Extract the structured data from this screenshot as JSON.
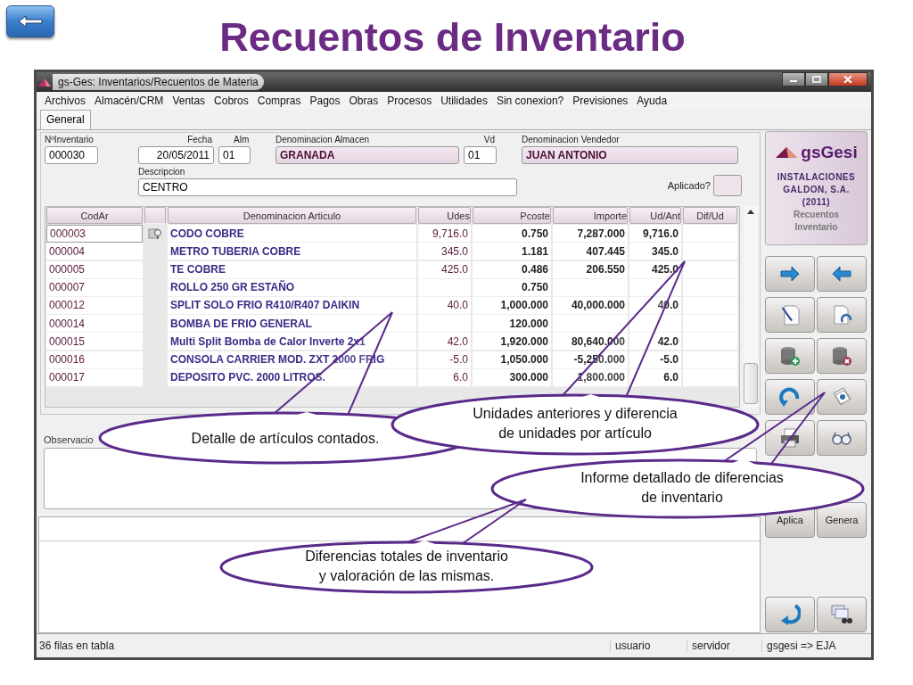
{
  "slide": {
    "title": "Recuentos de Inventario"
  },
  "window": {
    "title": "gs-Ges: Inventarios/Recuentos de Materia"
  },
  "menu": [
    "Archivos",
    "Almacén/CRM",
    "Ventas",
    "Cobros",
    "Compras",
    "Pagos",
    "Obras",
    "Procesos",
    "Utilidades",
    "Sin conexion?",
    "Previsiones",
    "Ayuda"
  ],
  "tabs": [
    {
      "label": "General",
      "selected": true
    }
  ],
  "form": {
    "fields": [
      {
        "label": "NºInventario",
        "value": "000030",
        "readonly": false
      },
      {
        "label": "Fecha",
        "value": "20/05/2011",
        "readonly": false
      },
      {
        "label": "Alm",
        "value": "01",
        "readonly": false
      },
      {
        "label": "Denominacion Almacen",
        "value": "GRANADA",
        "readonly": true
      },
      {
        "label": "Vd",
        "value": "01",
        "readonly": false
      },
      {
        "label": "Denominacion Vendedor",
        "value": "JUAN ANTONIO",
        "readonly": true
      }
    ],
    "descripcion": {
      "label": "Descripcion",
      "value": "CENTRO"
    },
    "aplicado": {
      "label": "Aplicado?",
      "checked": false
    }
  },
  "table": {
    "columns": [
      "CodAr",
      "Denominacion Articulo",
      "Udes",
      "Pcoste",
      "Importe",
      "Ud/Ant",
      "Dif/Ud"
    ],
    "rows": [
      {
        "codar": "000003",
        "articulo": "CODO COBRE",
        "udes": "9,716.0",
        "pcoste": "0.750",
        "importe": "7,287.000",
        "ud_ant": "9,716.0",
        "focused": true,
        "row_icon": true
      },
      {
        "codar": "000004",
        "articulo": "METRO TUBERIA COBRE",
        "udes": "345.0",
        "pcoste": "1.181",
        "importe": "407.445",
        "ud_ant": "345.0",
        "focused": false,
        "row_icon": false
      },
      {
        "codar": "000005",
        "articulo": "TE COBRE",
        "udes": "425.0",
        "pcoste": "0.486",
        "importe": "206.550",
        "ud_ant": "425.0",
        "focused": false,
        "row_icon": false
      },
      {
        "codar": "000007",
        "articulo": "ROLLO 250 GR ESTAÑO",
        "pcoste": "0.750",
        "focused": false,
        "row_icon": false
      },
      {
        "codar": "000012",
        "articulo": "SPLIT SOLO FRIO R410/R407 DAIKIN",
        "udes": "40.0",
        "pcoste": "1,000.000",
        "importe": "40,000.000",
        "ud_ant": "40.0",
        "focused": false,
        "row_icon": false
      },
      {
        "codar": "000014",
        "articulo": "BOMBA DE FRIO GENERAL",
        "pcoste": "120.000",
        "focused": false,
        "row_icon": false
      },
      {
        "codar": "000015",
        "articulo": "Multi Split Bomba de Calor Inverte 2x1",
        "udes": "42.0",
        "pcoste": "1,920.000",
        "importe": "80,640.000",
        "ud_ant": "42.0",
        "focused": false,
        "row_icon": false
      },
      {
        "codar": "000016",
        "articulo": "CONSOLA CARRIER MOD. ZXT 2000 FRIG",
        "udes": "-5.0",
        "pcoste": "1,050.000",
        "importe": "-5,250.000",
        "ud_ant": "-5.0",
        "focused": false,
        "row_icon": false
      },
      {
        "codar": "000017",
        "articulo": "DEPOSITO PVC. 2000 LITROS.",
        "udes": "6.0",
        "pcoste": "300.000",
        "importe": "1,800.000",
        "ud_ant": "6.0",
        "focused": false,
        "row_icon": false
      }
    ]
  },
  "observaciones": {
    "label": "Observacio"
  },
  "sidebar": {
    "logo": {
      "brand": "gsGesi",
      "company": "INSTALACIONES GALDON, S.A. (2011)",
      "module": "Recuentos Inventario"
    },
    "actions": [
      "Aplica",
      "Genera"
    ]
  },
  "status_bar": [
    "36 filas en tabla",
    "usuario",
    "servidor",
    "gsgesi => EJA"
  ],
  "callouts": [
    {
      "lines": [
        "Detalle de artículos contados."
      ]
    },
    {
      "lines": [
        "Unidades anteriores y diferencia",
        "de unidades por artículo"
      ]
    },
    {
      "lines": [
        "Informe detallado de diferencias",
        "de inventario"
      ]
    },
    {
      "lines": [
        "Diferencias totales de inventario",
        "y valoración de las mismas."
      ]
    }
  ]
}
